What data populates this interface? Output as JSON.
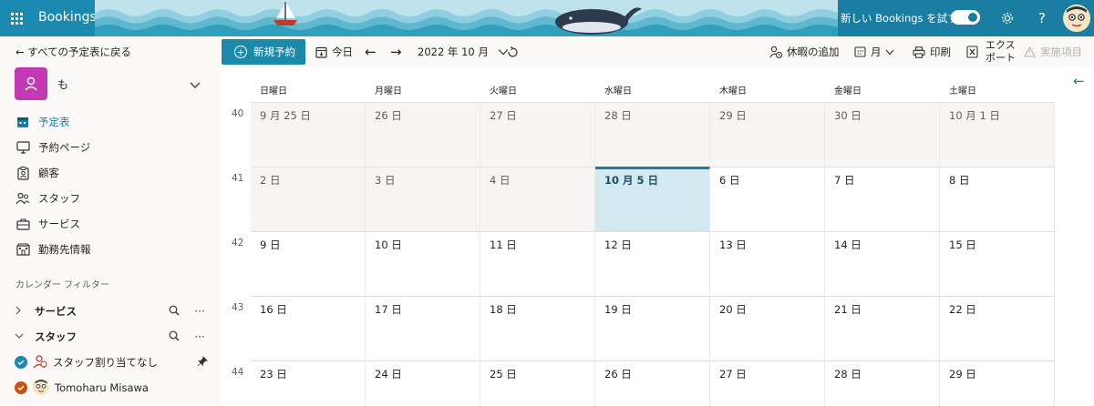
{
  "header": {
    "app_name": "Bookings",
    "try_new_label": "新しい Bookings を試す",
    "help_label": "?"
  },
  "nav": {
    "back_label": "すべての予定表に戻る",
    "calendar_name": "も",
    "items": [
      {
        "label": "予定表",
        "icon": "calendar-icon",
        "active": true
      },
      {
        "label": "予約ページ",
        "icon": "monitor-icon"
      },
      {
        "label": "顧客",
        "icon": "contact-card-icon"
      },
      {
        "label": "スタッフ",
        "icon": "people-icon"
      },
      {
        "label": "サービス",
        "icon": "briefcase-icon"
      },
      {
        "label": "勤務先情報",
        "icon": "building-icon"
      }
    ],
    "filter_heading": "カレンダー フィルター",
    "filters": [
      {
        "label": "サービス",
        "expanded": false
      },
      {
        "label": "スタッフ",
        "expanded": true
      }
    ],
    "staff": [
      {
        "label": "スタッフ割り当てなし",
        "color": "#1a8ab1"
      },
      {
        "label": "Tomoharu Misawa",
        "color": "#ca5010"
      }
    ]
  },
  "toolbar": {
    "new_booking": "新規予約",
    "today": "今日",
    "month_label": "2022 年 10 月",
    "add_time_off": "休暇の追加",
    "view": "月",
    "print": "印刷",
    "export_line1": "エクス",
    "export_line2": "ポート",
    "implemented": "実施項目"
  },
  "calendar": {
    "weekdays": [
      "日曜日",
      "月曜日",
      "火曜日",
      "水曜日",
      "木曜日",
      "金曜日",
      "土曜日"
    ],
    "weeks": [
      {
        "num": "40",
        "days": [
          "9 月 25 日",
          "26 日",
          "27 日",
          "28 日",
          "29 日",
          "30 日",
          "10 月 1 日"
        ]
      },
      {
        "num": "41",
        "days": [
          "2 日",
          "3 日",
          "4 日",
          "10 月 5 日",
          "6 日",
          "7 日",
          "8 日"
        ]
      },
      {
        "num": "42",
        "days": [
          "9 日",
          "10 日",
          "11 日",
          "12 日",
          "13 日",
          "14 日",
          "15 日"
        ]
      },
      {
        "num": "43",
        "days": [
          "16 日",
          "17 日",
          "18 日",
          "19 日",
          "20 日",
          "21 日",
          "22 日"
        ]
      },
      {
        "num": "44",
        "days": [
          "23 日",
          "24 日",
          "25 日",
          "26 日",
          "27 日",
          "28 日",
          "29 日"
        ]
      }
    ],
    "today_label": "10 月 5 日"
  },
  "colors": {
    "accent": "#1a7ea3",
    "header": "#1b8ab1",
    "avatar": "#c239b3",
    "today_bg": "#d2e9ef"
  }
}
